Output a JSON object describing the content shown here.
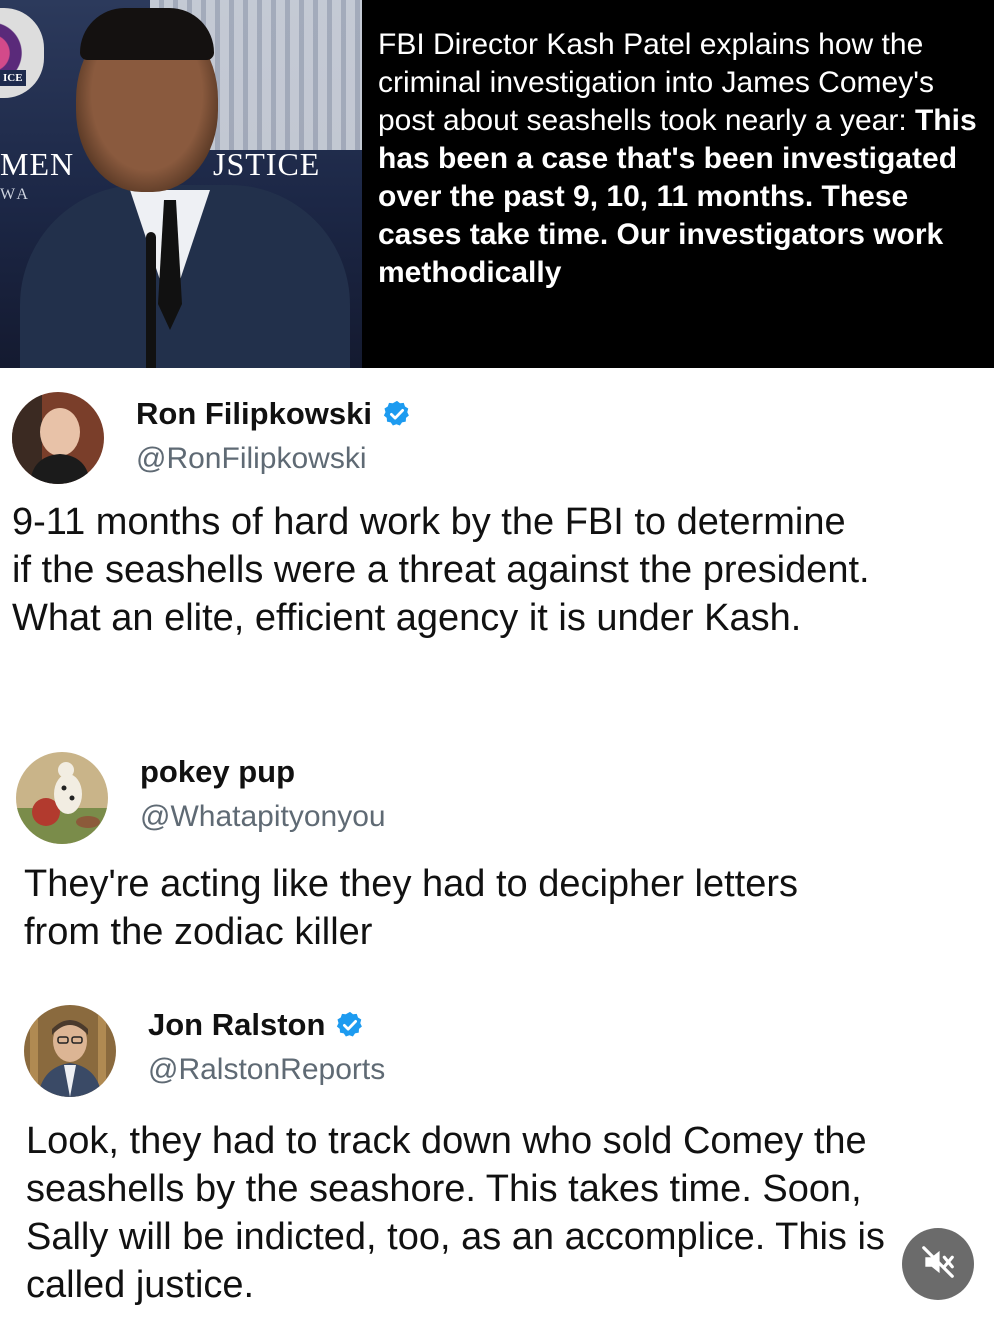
{
  "news": {
    "backdrop_words": [
      "MEN",
      "JSTICE",
      "WA",
      "ICE"
    ],
    "caption_intro": "FBI Director Kash Patel explains how the criminal investigation into James Comey's post about seashells took nearly a year: ",
    "caption_quote": "This has been a case that's been investigated over the past 9, 10, 11 months. These cases take time. Our investigators work methodically"
  },
  "tweets": [
    {
      "name": "Ron Filipkowski",
      "handle": "@RonFilipkowski",
      "verified": true,
      "text": "9-11 months of hard work by the FBI to determine if the seashells were a threat against the president. What an elite, efficient agency it is under Kash."
    },
    {
      "name": "pokey pup",
      "handle": "@Whatapityonyou",
      "verified": false,
      "text": "They're acting like they had to decipher letters from the zodiac killer"
    },
    {
      "name": "Jon Ralston",
      "handle": "@RalstonReports",
      "verified": true,
      "text": "Look, they had to track down who sold Comey the seashells by the seashore. This takes time. Soon, Sally will be indicted, too, as an accomplice. This is called justice."
    }
  ],
  "icons": {
    "verified": "verified-badge-icon",
    "mute": "muted-speaker-icon"
  },
  "colors": {
    "verified_blue": "#1d9bf0",
    "handle_gray": "#5f6a74",
    "header_bg": "#000000"
  }
}
